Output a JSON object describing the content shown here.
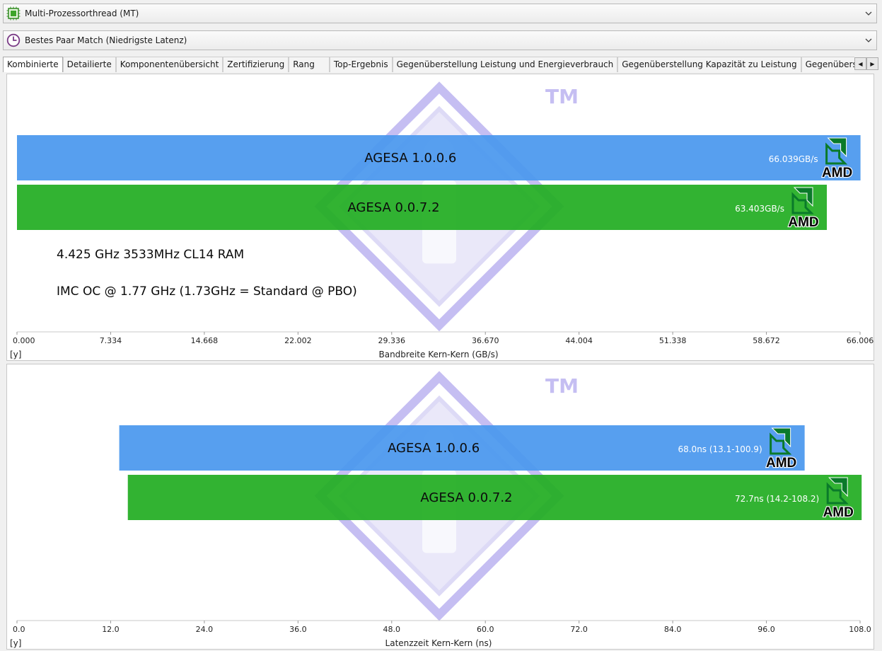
{
  "header": {
    "mode_selector": {
      "label": "Multi-Prozessorthread (MT)"
    },
    "match_selector": {
      "label": "Bestes Paar Match (Niedrigste Latenz)"
    }
  },
  "tabs": [
    {
      "label": "Kombinierte",
      "active": true
    },
    {
      "label": "Detailierte"
    },
    {
      "label": "Komponentenübersicht"
    },
    {
      "label": "Zertifizierung"
    },
    {
      "label": "Rang"
    },
    {
      "label": "Top-Ergebnis"
    },
    {
      "label": "Gegenüberstellung Leistung und Energieverbrauch"
    },
    {
      "label": "Gegenüberstellung Kapazität zu Leistung"
    },
    {
      "label": "Gegenüberstellung Leistung und Gesc"
    }
  ],
  "watermark": {
    "tm": "TM"
  },
  "logo_text": "AMD",
  "colors": {
    "series1": "#4a98ee",
    "series2": "#22ad22",
    "watermark": "#8c7fe6"
  },
  "chart_data": [
    {
      "type": "bar",
      "orientation": "horizontal",
      "xlabel": "Bandbreite Kern-Kern (GB/s)",
      "ylabel": "[y]",
      "xlim": [
        0.0,
        66.006
      ],
      "ticks": [
        "0.000",
        "7.334",
        "14.668",
        "22.002",
        "29.336",
        "36.670",
        "44.004",
        "51.338",
        "58.672",
        "66.006"
      ],
      "bars": [
        {
          "name": "AGESA 1.0.0.6",
          "start": 0.0,
          "value": 66.039,
          "label": "66.039GB/s",
          "color": "#4a98ee"
        },
        {
          "name": "AGESA 0.0.7.2",
          "start": 0.0,
          "value": 63.403,
          "label": "63.403GB/s",
          "color": "#22ad22"
        }
      ],
      "annotations": [
        "4.425 GHz 3533MHz CL14 RAM",
        "IMC OC @ 1.77 GHz (1.73GHz = Standard @ PBO)"
      ]
    },
    {
      "type": "bar",
      "orientation": "horizontal",
      "xlabel": "Latenzzeit Kern-Kern (ns)",
      "ylabel": "[y]",
      "xlim": [
        0.0,
        108.0
      ],
      "ticks": [
        "0.0",
        "12.0",
        "24.0",
        "36.0",
        "48.0",
        "60.0",
        "72.0",
        "84.0",
        "96.0",
        "108.0"
      ],
      "bars": [
        {
          "name": "AGESA 1.0.0.6",
          "start": 13.1,
          "value": 100.9,
          "label": "68.0ns (13.1-100.9)",
          "color": "#4a98ee"
        },
        {
          "name": "AGESA 0.0.7.2",
          "start": 14.2,
          "value": 108.2,
          "label": "72.7ns (14.2-108.2)",
          "color": "#22ad22"
        }
      ],
      "annotations": []
    }
  ]
}
